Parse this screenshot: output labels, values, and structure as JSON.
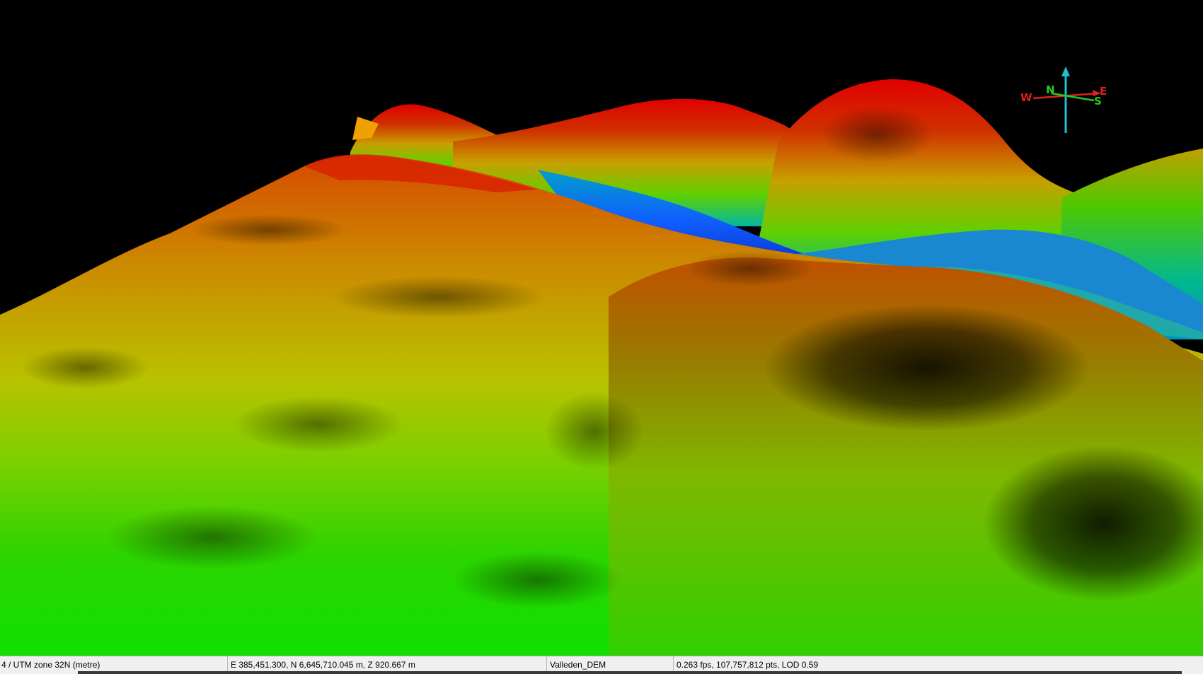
{
  "viewer": {
    "background_color": "#000000",
    "colormap": [
      "#0a28ff",
      "#00c8ff",
      "#00e000",
      "#b0e000",
      "#e0b000",
      "#e05000",
      "#e00000"
    ]
  },
  "compass": {
    "north_label": "N",
    "south_label": "S",
    "east_label": "E",
    "west_label": "W",
    "north_color": "#22cc22",
    "south_color": "#22cc22",
    "east_color": "#e02020",
    "west_color": "#e02020",
    "up_axis_color": "#20c0d0"
  },
  "statusbar": {
    "crs": "4 / UTM zone 32N (metre)",
    "coordinates": "E 385,451.300, N 6,645,710.045 m, Z 920.667 m",
    "layer": "Valleden_DEM",
    "performance": "0.263 fps, 107,757,812 pts, LOD 0.59"
  }
}
